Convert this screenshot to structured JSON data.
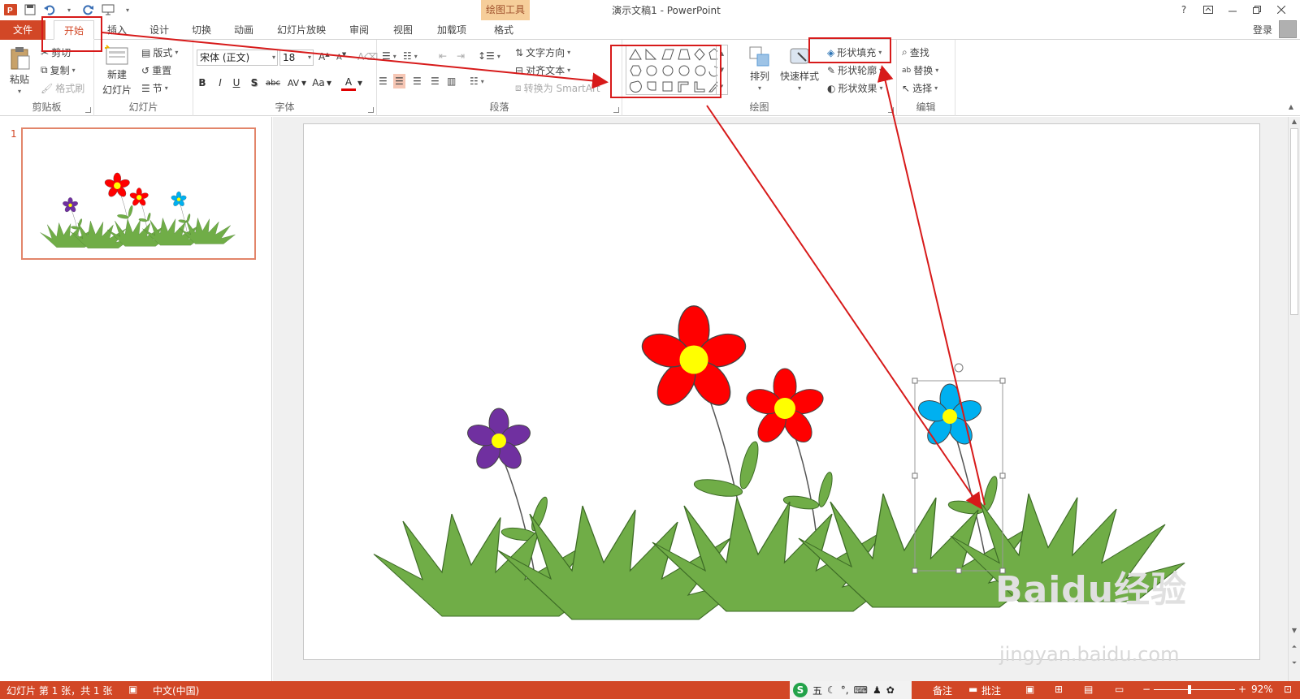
{
  "title_bar": {
    "doc_title": "演示文稿1 - PowerPoint",
    "contextual_tab_group": "绘图工具",
    "help_label": "?",
    "quick_access": [
      "save-icon",
      "undo-icon",
      "redo-icon",
      "start-from-beginning-icon"
    ]
  },
  "tabs": [
    {
      "label": "文件"
    },
    {
      "label": "开始"
    },
    {
      "label": "插入"
    },
    {
      "label": "设计"
    },
    {
      "label": "切换"
    },
    {
      "label": "动画"
    },
    {
      "label": "幻灯片放映"
    },
    {
      "label": "审阅"
    },
    {
      "label": "视图"
    },
    {
      "label": "加载项"
    },
    {
      "label": "格式"
    }
  ],
  "account": {
    "login_label": "登录"
  },
  "ribbon": {
    "clipboard": {
      "group_label": "剪贴板",
      "paste": "粘贴",
      "cut": "剪切",
      "copy": "复制",
      "format_painter": "格式刷"
    },
    "slides": {
      "group_label": "幻灯片",
      "new_slide_line1": "新建",
      "new_slide_line2": "幻灯片",
      "layout": "版式",
      "reset": "重置",
      "section": "节"
    },
    "font": {
      "group_label": "字体",
      "font_name": "宋体 (正文)",
      "font_size": "18",
      "bold": "B",
      "italic": "I",
      "underline": "U",
      "shadow": "S",
      "strike": "abc",
      "spacing": "AV",
      "case": "Aa",
      "color": "A"
    },
    "paragraph": {
      "group_label": "段落",
      "text_direction": "文字方向",
      "align_text": "对齐文本",
      "convert_smartart": "转换为 SmartArt"
    },
    "drawing": {
      "group_label": "绘图",
      "arrange": "排列",
      "quick_styles": "快速样式",
      "shape_fill": "形状填充",
      "shape_outline": "形状轮廓",
      "shape_effects": "形状效果"
    },
    "editing": {
      "group_label": "编辑",
      "find": "查找",
      "replace": "替换",
      "select": "选择"
    }
  },
  "slide_pane": {
    "slide_number": "1"
  },
  "status_bar": {
    "slide_info": "幻灯片 第 1 张，共 1 张",
    "language": "中文(中国)",
    "ime_mode": "五",
    "notes": "备注",
    "comments": "批注",
    "zoom": "92%"
  },
  "watermark": {
    "brand": "Baidu经验",
    "url": "jingyan.baidu.com"
  },
  "colors": {
    "accent": "#d24726",
    "annotation_red": "#d71a1a",
    "grass": "#70ad47",
    "flower_red": "#ff0000",
    "flower_purple": "#7030a0",
    "flower_blue": "#00b0f0",
    "flower_center": "#ffff00"
  }
}
